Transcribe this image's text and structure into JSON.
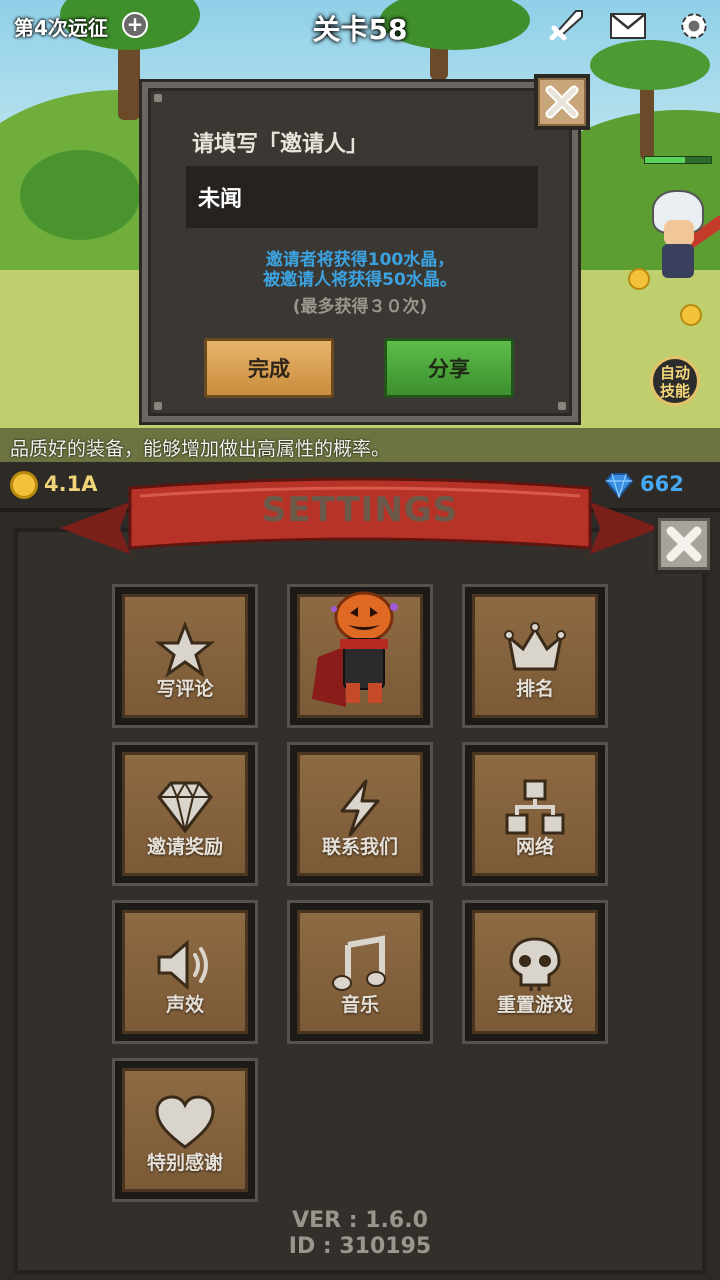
{
  "hud": {
    "expedition": "第4次远征",
    "stage": "关卡58",
    "tip": "品质好的装备，能够增加做出高属性的概率。",
    "auto_skill": "自动技能"
  },
  "currency": {
    "gold": "4.1A",
    "gems": "662"
  },
  "invite_dialog": {
    "title": "请填写「邀请人」",
    "input_value": "未闻",
    "info_line1": "邀请者将获得100水晶，",
    "info_line2": "被邀请人将获得50水晶。",
    "limit": "(最多获得３０次)",
    "done_label": "完成",
    "share_label": "分享"
  },
  "settings": {
    "title": "SETTINGS",
    "items": [
      {
        "label": "写评论",
        "icon": "star-icon"
      },
      {
        "label": "",
        "icon": "pumpkin-character-icon"
      },
      {
        "label": "排名",
        "icon": "crown-icon"
      },
      {
        "label": "邀请奖励",
        "icon": "diamond-icon"
      },
      {
        "label": "联系我们",
        "icon": "lightning-icon"
      },
      {
        "label": "网络",
        "icon": "network-icon"
      },
      {
        "label": "声效",
        "icon": "speaker-icon"
      },
      {
        "label": "音乐",
        "icon": "music-note-icon"
      },
      {
        "label": "重置游戏",
        "icon": "skull-icon"
      },
      {
        "label": "特别感谢",
        "icon": "heart-icon"
      }
    ],
    "version": "VER : 1.6.0",
    "id": "ID : 310195"
  }
}
